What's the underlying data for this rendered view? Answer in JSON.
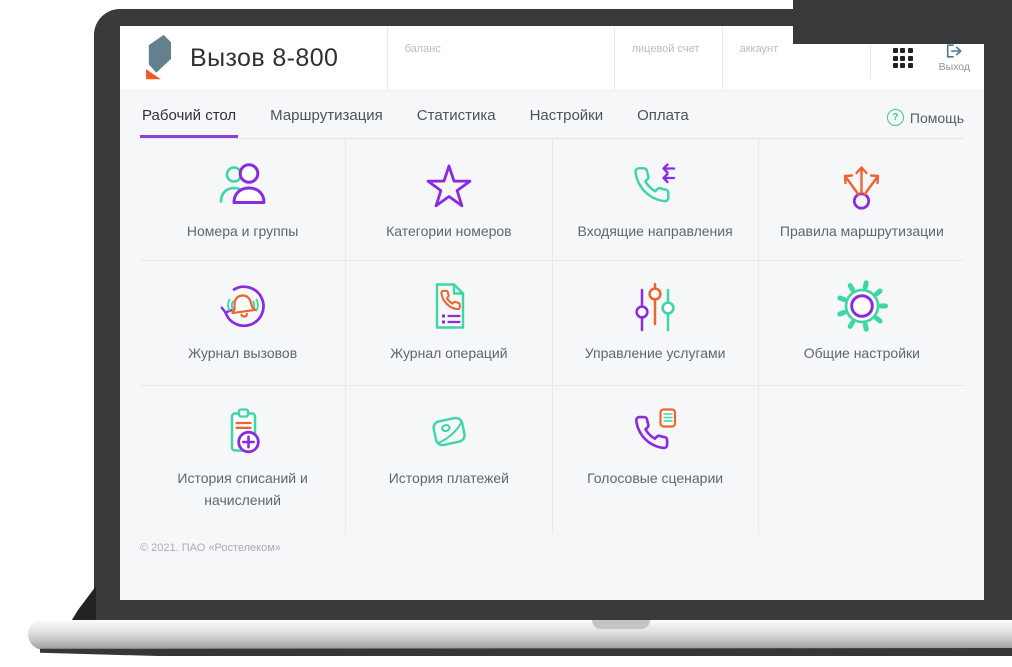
{
  "header": {
    "app_title": "Вызов 8-800",
    "field_labels": [
      "баланс",
      "лицевой счет",
      "аккаунт"
    ],
    "logout_label": "Выход"
  },
  "nav": {
    "tabs": [
      {
        "label": "Рабочий стол",
        "active": true
      },
      {
        "label": "Маршрутизация",
        "active": false
      },
      {
        "label": "Статистика",
        "active": false
      },
      {
        "label": "Настройки",
        "active": false
      },
      {
        "label": "Оплата",
        "active": false
      }
    ],
    "help_label": "Помощь"
  },
  "tiles": [
    {
      "label": "Номера и группы",
      "icon": "users-icon"
    },
    {
      "label": "Категории номеров",
      "icon": "star-icon"
    },
    {
      "label": "Входящие направления",
      "icon": "incoming-call-icon"
    },
    {
      "label": "Правила маршрутизации",
      "icon": "routing-arrows-icon"
    },
    {
      "label": "Журнал вызовов",
      "icon": "call-log-bell-icon"
    },
    {
      "label": "Журнал операций",
      "icon": "operations-document-icon"
    },
    {
      "label": "Управление услугами",
      "icon": "sliders-icon"
    },
    {
      "label": "Общие настройки",
      "icon": "gear-icon"
    },
    {
      "label": "История списаний и начислений",
      "icon": "clipboard-plus-icon"
    },
    {
      "label": "История платежей",
      "icon": "wallet-icon"
    },
    {
      "label": "Голосовые сценарии",
      "icon": "voice-script-phone-icon"
    }
  ],
  "footer": {
    "copyright": "© 2021. ПАО «Ростелеком»"
  },
  "colors": {
    "accent_purple": "#8a2be2",
    "accent_green": "#3dd6a4",
    "accent_orange": "#ee6431",
    "tab_underline": "#8f3fe0",
    "logo_slate": "#64808e",
    "logo_orange": "#f05a28"
  }
}
